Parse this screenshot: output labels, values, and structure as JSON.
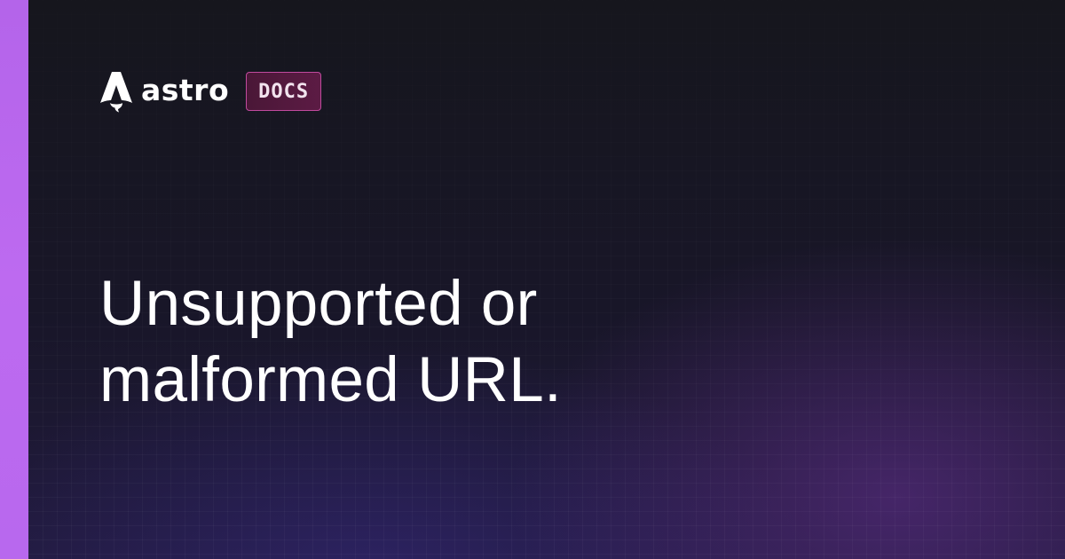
{
  "brand": {
    "wordmark": "astro",
    "badge": "DOCS",
    "logo_icon": "astro-rocket-icon"
  },
  "message": {
    "line1": "Unsupported or",
    "line2": "malformed URL."
  },
  "colors": {
    "accent_bar": "#bd6af0",
    "background": "#16161d",
    "badge_border": "#c04a9e",
    "badge_fill": "#5c1b44",
    "text": "#ffffff"
  }
}
